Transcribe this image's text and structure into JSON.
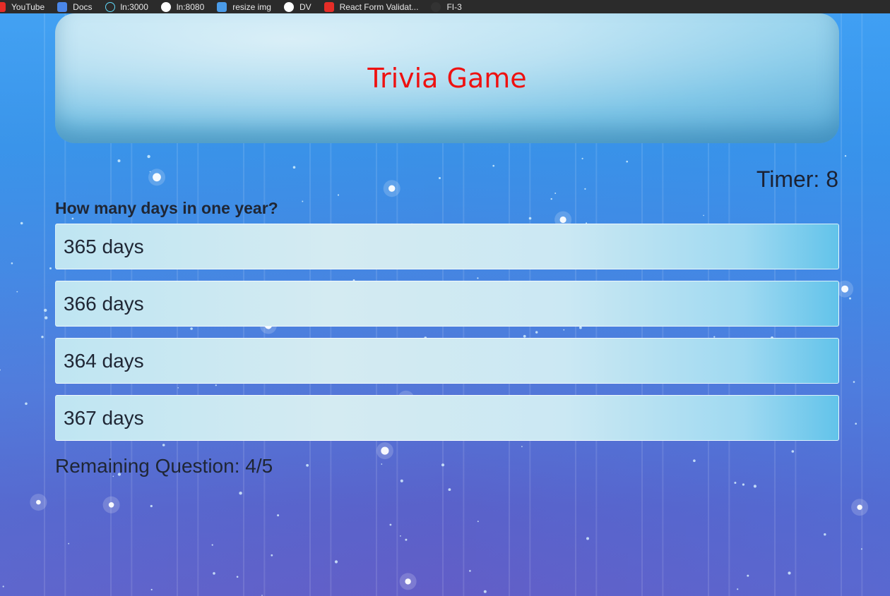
{
  "bookmarks": [
    {
      "label": "YouTube",
      "icon": "youtube-icon",
      "color": "#e52d27"
    },
    {
      "label": "Docs",
      "icon": "docs-icon",
      "color": "#4a86e8"
    },
    {
      "label": "ln:3000",
      "icon": "react-icon",
      "color": "#61dafb"
    },
    {
      "label": "ln:8080",
      "icon": "globe-icon",
      "color": "#ffffff"
    },
    {
      "label": "resize img",
      "icon": "image-icon",
      "color": "#4a9be8"
    },
    {
      "label": "DV",
      "icon": "globe-icon",
      "color": "#ffffff"
    },
    {
      "label": "React Form Validat...",
      "icon": "youtube-icon",
      "color": "#e52d27"
    },
    {
      "label": "FI-3",
      "icon": "github-icon",
      "color": "#333333"
    }
  ],
  "header": {
    "title": "Trivia Game",
    "title_color": "#ee1111"
  },
  "timer": {
    "text": "Timer: 8"
  },
  "question": {
    "text": "How many days in one year?"
  },
  "answers": [
    {
      "label": "365 days"
    },
    {
      "label": "366 days"
    },
    {
      "label": "364 days"
    },
    {
      "label": "367 days"
    }
  ],
  "progress": {
    "text": "Remaining Question: 4/5"
  }
}
